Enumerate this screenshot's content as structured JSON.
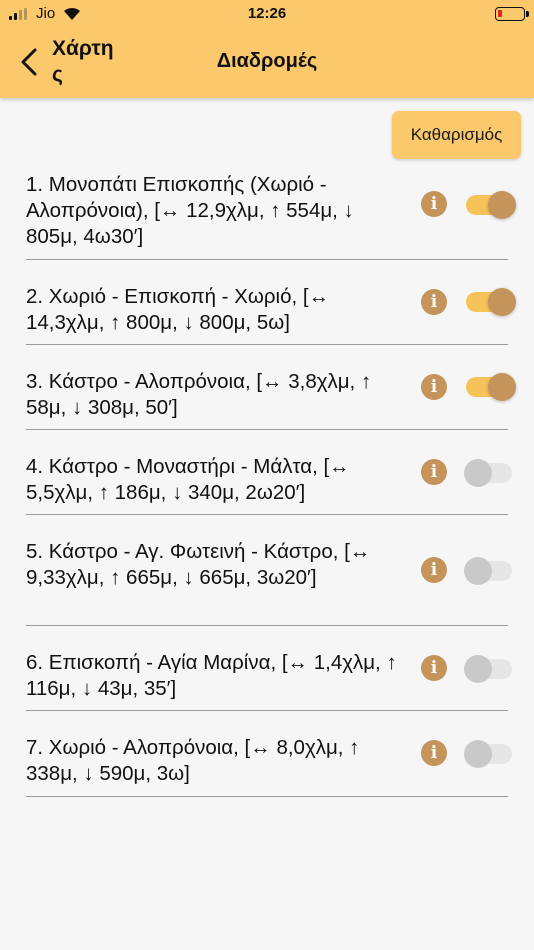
{
  "status_bar": {
    "carrier": "Jio",
    "time": "12:26"
  },
  "nav": {
    "back_label": "Χάρτης",
    "title": "Διαδρομές"
  },
  "clear_button_label": "Καθαρισμός",
  "colors": {
    "accent": "#fbc96b",
    "toggle_on_track": "#f6c25a",
    "toggle_on_thumb": "#c4945a",
    "info_icon": "#c4945a",
    "toggle_off": "#c9c9c9"
  },
  "routes": [
    {
      "label": "1. Μονοπάτι Επισκοπής (Χωριό - Αλοπρόνοια), [↔ 12,9χλμ, ↑ 554μ, ↓ 805μ, 4ω30′]",
      "enabled": true
    },
    {
      "label": "2. Χωριό - Επισκοπή - Χωριό, [↔ 14,3χλμ, ↑ 800μ, ↓ 800μ, 5ω]",
      "enabled": true
    },
    {
      "label": "3. Κάστρο - Αλοπρόνοια, [↔ 3,8χλμ, ↑ 58μ, ↓ 308μ, 50′]",
      "enabled": true
    },
    {
      "label": "4. Κάστρο - Μοναστήρι - Μάλτα, [↔ 5,5χλμ, ↑ 186μ, ↓ 340μ, 2ω20′]",
      "enabled": false
    },
    {
      "label": "5. Κάστρο - Αγ. Φωτεινή - Κάστρο, [↔ 9,33χλμ, ↑ 665μ, ↓ 665μ, 3ω20′]",
      "enabled": false
    },
    {
      "label": "6. Επισκοπή - Αγία Μαρίνα, [↔ 1,4χλμ, ↑ 116μ, ↓ 43μ, 35′]",
      "enabled": false
    },
    {
      "label": "7. Χωριό - Αλοπρόνοια, [↔ 8,0χλμ, ↑ 338μ, ↓ 590μ, 3ω]",
      "enabled": false
    }
  ],
  "icons": {
    "info": "info-icon",
    "back": "chevron-left-icon"
  }
}
